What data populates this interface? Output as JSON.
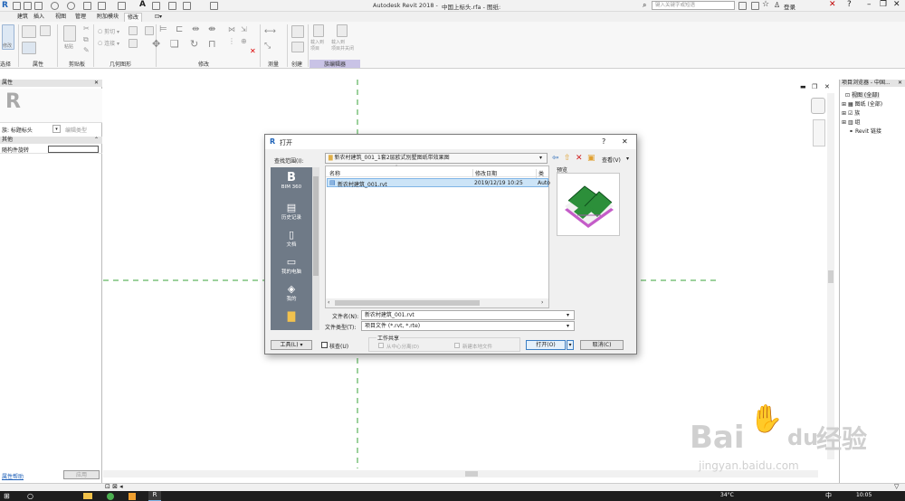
{
  "window": {
    "app_title": "Autodesk Revit 2018 -",
    "doc_title": "中国上标头.rfa - 图纸:",
    "search_placeholder": "键入关键字或短语",
    "login": "登录"
  },
  "ribbon": {
    "tabs": [
      "建筑",
      "插入",
      "视图",
      "管理",
      "附加模块",
      "修改"
    ],
    "active_tab": "修改",
    "panels": [
      {
        "label": "选择"
      },
      {
        "label": "属性"
      },
      {
        "label": "剪贴板"
      },
      {
        "label": "几何图形"
      },
      {
        "label": "修改"
      },
      {
        "label": "测量"
      },
      {
        "label": "创建"
      },
      {
        "label": "族编辑器"
      }
    ],
    "buttons": {
      "modify": "修改",
      "paste": "粘贴",
      "cut": "剪切",
      "join": "连接",
      "load_project": "载入到\n项目",
      "load_close": "载入到\n项目并关闭"
    }
  },
  "properties": {
    "title": "属性",
    "family_type": "族: 标题标头",
    "edit_type": "编辑类型",
    "group": "其他",
    "param_name": "随构件旋转",
    "help_link": "属性帮助",
    "apply": "应用"
  },
  "browser": {
    "title": "项目浏览器 - 中国...",
    "items": [
      "视图 (全部)",
      "图纸 (全部)",
      "族",
      "组",
      "Revit 链接"
    ]
  },
  "dialog": {
    "title": "打开",
    "help": "?",
    "close": "✕",
    "lookin_label": "查找范围(I):",
    "lookin_value": "新农村建筑_001_1套2层欧式别墅图纸带效果图",
    "view_menu": "查看(V)",
    "preview_label": "预览",
    "places": [
      "BIM 360",
      "历史记录",
      "文档",
      "我的电脑",
      "我的"
    ],
    "columns": [
      "名称",
      "修改日期",
      "类型"
    ],
    "files": [
      {
        "name": "新农村建筑_001.rvt",
        "date": "2019/12/19 10:25",
        "type": "Auto"
      }
    ],
    "filename_label": "文件名(N):",
    "filename_value": "新农村建筑_001.rvt",
    "filetype_label": "文件类型(T):",
    "filetype_value": "项目文件 (*.rvt, *.rte)",
    "worksharing_label": "工作共享",
    "detach_label": "从中心分离(D)",
    "new_local_label": "新建本地文件",
    "tools_btn": "工具(L)",
    "audit_label": "核查(U)",
    "open_btn": "打开(O)",
    "cancel_btn": "取消(C)"
  },
  "taskbar": {
    "temperature": "34°C",
    "ime": "中",
    "time": "10:05"
  },
  "watermark": {
    "text1": "Bai",
    "text2": "du",
    "text3": "经验",
    "url": "jingyan.baidu.com"
  },
  "colors": {
    "selection": "#cce4f7",
    "places_bg": "#6f7a87",
    "guide_line": "#3aa33a",
    "preview_green": "#2c8f3a",
    "preview_purple": "#c45cc8"
  }
}
